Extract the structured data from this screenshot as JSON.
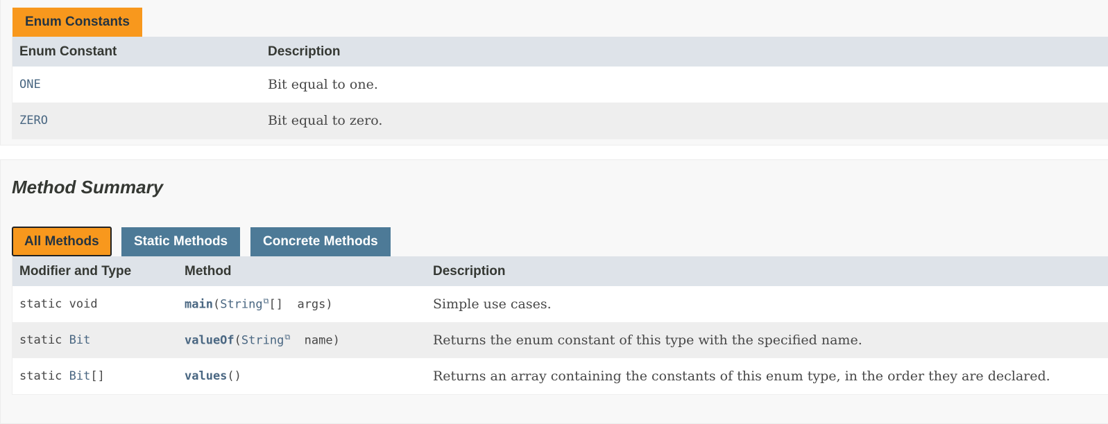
{
  "enum_section": {
    "tab_label": "Enum Constants",
    "headers": [
      "Enum Constant",
      "Description"
    ],
    "rows": [
      {
        "name": "ONE",
        "description": "Bit equal to one."
      },
      {
        "name": "ZERO",
        "description": "Bit equal to zero."
      }
    ]
  },
  "method_section": {
    "title": "Method Summary",
    "tabs": [
      {
        "label": "All Methods",
        "active": true
      },
      {
        "label": "Static Methods",
        "active": false
      },
      {
        "label": "Concrete Methods",
        "active": false
      }
    ],
    "headers": [
      "Modifier and Type",
      "Method",
      "Description"
    ],
    "rows": [
      {
        "modifier": "static",
        "type": "void",
        "type_is_link": false,
        "type_suffix": "",
        "method_name": "main",
        "param_type": "String",
        "param_suffix": "[]",
        "param_name": "args",
        "description": "Simple use cases."
      },
      {
        "modifier": "static",
        "type": "Bit",
        "type_is_link": true,
        "type_suffix": "",
        "method_name": "valueOf",
        "param_type": "String",
        "param_suffix": "",
        "param_name": "name",
        "description": "Returns the enum constant of this type with the specified name."
      },
      {
        "modifier": "static",
        "type": "Bit",
        "type_is_link": true,
        "type_suffix": "[]",
        "method_name": "values",
        "param_type": "",
        "param_suffix": "",
        "param_name": "",
        "description": "Returns an array containing the constants of this enum type, in the order they are declared."
      }
    ]
  },
  "punctuation": {
    "open_paren": "(",
    "close_paren": ")",
    "external_link_icon": "⧉"
  },
  "colors": {
    "tab_active": "#f8981d",
    "tab_inactive": "#4d7a97",
    "header_bg": "#dee3e9",
    "link": "#4a6782"
  }
}
